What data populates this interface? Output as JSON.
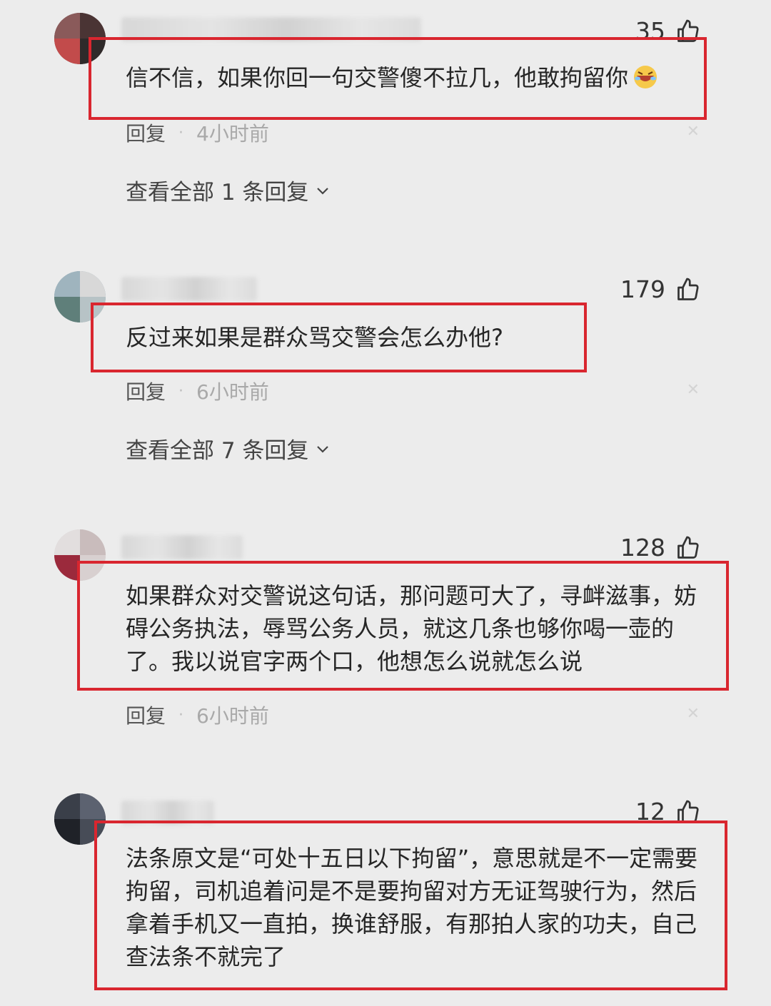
{
  "comments": [
    {
      "likes": "35",
      "text_lines": [
        "信不信，如果你回一句交警傻不拉几，他敢拘留你"
      ],
      "reply_label": "回复",
      "time": "4小时前",
      "view_all": "查看全部 1 条回复"
    },
    {
      "likes": "179",
      "text_lines": [
        "反过来如果是群众骂交警会怎么办他?"
      ],
      "reply_label": "回复",
      "time": "6小时前",
      "view_all": "查看全部 7 条回复"
    },
    {
      "likes": "128",
      "text_lines": [
        "如果群众对交警说这句话，那问题可大了，寻衅滋事，妨",
        "碍公务执法，辱骂公务人员，就这几条也够你喝一壶的",
        "了。我以说官字两个口，他想怎么说就怎么说"
      ],
      "reply_label": "回复",
      "time": "6小时前"
    },
    {
      "likes": "12",
      "text_lines": [
        "法条原文是“可处十五日以下拘留”，意思就是不一定需要",
        "拘留，司机追着问是不是要拘留对方无证驾驶行为，然后",
        "拿着手机又一直拍，换谁舒服，有那拍人家的功夫，自己",
        "查法条不就完了"
      ]
    }
  ],
  "colors": {
    "highlight_box": "#d9262f",
    "background": "#ececec"
  },
  "icons": {
    "like": "thumbs-up-icon",
    "emoji": "laughing-face-emoji-icon",
    "chevron": "chevron-down-icon"
  }
}
